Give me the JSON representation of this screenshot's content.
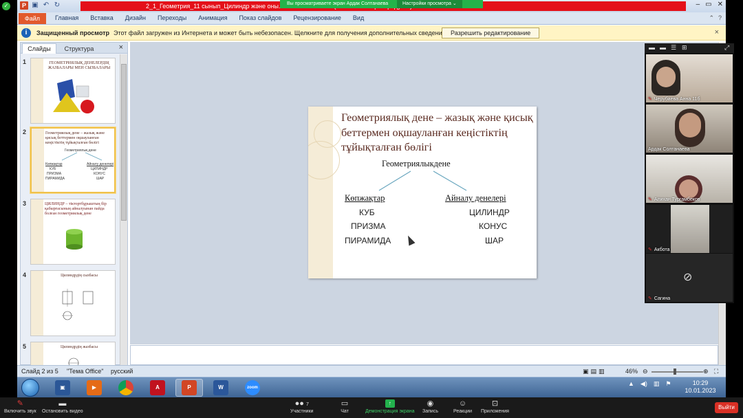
{
  "zoom_banner": {
    "viewing": "Вы просматриваете экран Ардак Солтанаева",
    "view_options": "Настройки просмотра ⌄"
  },
  "window": {
    "title": "2_1_Геометрия_11 сынып_Цилиндр және оны...                                                                   osoft PowerPoint (Сбой активации продукта)"
  },
  "ribbon": {
    "file": "Файл",
    "tabs": [
      "Главная",
      "Вставка",
      "Дизайн",
      "Переходы",
      "Анимация",
      "Показ слайдов",
      "Рецензирование",
      "Вид"
    ]
  },
  "protected_bar": {
    "label": "Защищенный просмотр",
    "message": "Этот файл загружен из Интернета и может быть небезопасен. Щелкните для получения дополнительных сведений.",
    "button": "Разрешить редактирование",
    "close": "×"
  },
  "slides_panel": {
    "tab_slides": "Слайды",
    "tab_outline": "Структура",
    "close": "×",
    "thumbnails": [
      {
        "number": "1",
        "title": "ГЕОМЕТРИЯЛЫҚ ДЕНЕЛЕРДІҢ ЖАЗБАЛАРЫ МЕН СЫЗБАЛАРЫ"
      },
      {
        "number": "2",
        "title": "Геометриялық дене – жазық және қисық беттермен оқшауланған кеңістіктің тұйықталған бөлігі",
        "root": "Геометриялық дене",
        "left": [
          "Көпжақтар",
          "КУБ",
          "ПРИЗМА",
          "ПИРАМИДА"
        ],
        "right": [
          "Айналу денелері",
          "ЦИЛИНДР",
          "КОНУС",
          "ШАР"
        ]
      },
      {
        "number": "3",
        "title": "ЦИЛИНДР – тіктортбұрыштың бір қабырғасының айналуынан пайда болған геометриялық дене"
      },
      {
        "number": "4",
        "title": "Цилиндрдің сызбасы"
      },
      {
        "number": "5",
        "title": "Цилиндрдің жазбасы"
      }
    ]
  },
  "slide": {
    "title": "Геометриялық дене – жазық және қисық беттермен оқшауланған кеңістіктің тұйықталған бөлігі",
    "root": "Геометриялыкдене",
    "left_heading": "Көпжақтар",
    "left_items": [
      "КУБ",
      "ПРИЗМА",
      "ПИРАМИДА"
    ],
    "right_heading": "Айналу денелері",
    "right_items": [
      "ЦИЛИНДР",
      "КОНУС",
      "ШАР"
    ]
  },
  "status_bar": {
    "slide_counter": "Слайд 2 из 5",
    "theme": "\"Тема Office\"",
    "language": "русский",
    "zoom": "46%"
  },
  "taskbar": {
    "time": "10:29",
    "date": "10.01.2023"
  },
  "zoom_gallery": {
    "participants": [
      {
        "name": "Черубаева Анна 11б"
      },
      {
        "name": "Ардак Солтанаева"
      },
      {
        "name": "Алихан Тургамбеков"
      },
      {
        "name": "Акбота"
      },
      {
        "name": "Сагина"
      }
    ]
  },
  "zoom_controls": {
    "mute": "Включить звук",
    "video": "Остановить видео",
    "participants_count": "7",
    "participants": "Участники",
    "chat": "Чат",
    "share": "Демонстрация экрана",
    "record": "Запись",
    "reactions": "Реакции",
    "apps": "Приложения",
    "leave": "Выйти"
  },
  "colors": {
    "zoom_green": "#24b34a",
    "title_red": "#e41019",
    "slide_title": "#5a2a20",
    "connector": "#6aa7bf"
  }
}
